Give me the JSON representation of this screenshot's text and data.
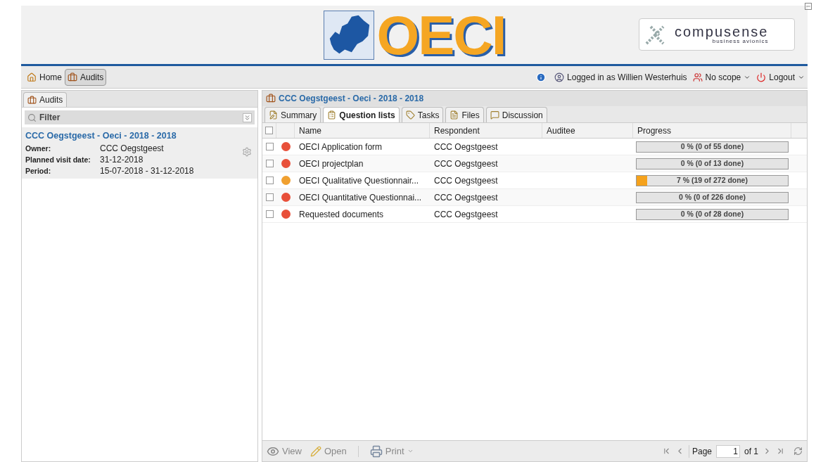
{
  "header": {
    "logo_text": "OECI",
    "partner_logo": {
      "name": "compusense",
      "tagline": "business avionics"
    }
  },
  "nav": {
    "items": [
      {
        "label": "Home",
        "selected": false
      },
      {
        "label": "Audits",
        "selected": true
      }
    ],
    "user": "Logged in as Willien Westerhuis",
    "scope": "No scope",
    "logout": "Logout"
  },
  "sidebar": {
    "tab": "Audits",
    "filter": "Filter",
    "audit": {
      "title": "CCC Oegstgeest - Oeci - 2018 - 2018",
      "fields": [
        {
          "label": "Owner:",
          "value": "CCC Oegstgeest"
        },
        {
          "label": "Planned visit date:",
          "value": "31-12-2018"
        },
        {
          "label": "Period:",
          "value": "15-07-2018 - 31-12-2018"
        }
      ]
    }
  },
  "detail": {
    "title": "CCC Oegstgeest - Oeci - 2018 - 2018",
    "tabs": [
      {
        "label": "Summary",
        "selected": false
      },
      {
        "label": "Question lists",
        "selected": true
      },
      {
        "label": "Tasks",
        "selected": false
      },
      {
        "label": "Files",
        "selected": false
      },
      {
        "label": "Discussion",
        "selected": false
      }
    ],
    "table": {
      "all_checked": false,
      "columns": [
        "Name",
        "Respondent",
        "Auditee",
        "Progress"
      ],
      "rows": [
        {
          "checked": false,
          "color": "#e8503a",
          "name": "OECI Application form",
          "respondent": "CCC Oegstgeest",
          "level": 0,
          "progress": "0 % (0 of 55 done)"
        },
        {
          "checked": false,
          "color": "#e8503a",
          "name": "OECI projectplan",
          "respondent": "CCC Oegstgeest",
          "level": 0,
          "progress": "0 % (0 of 13 done)"
        },
        {
          "checked": false,
          "color": "#f0a030",
          "name": "OECI Qualitative Questionnair...",
          "respondent": "CCC Oegstgeest",
          "level": 0.07,
          "progress": "7 % (19 of 272 done)"
        },
        {
          "checked": false,
          "color": "#e8503a",
          "name": "OECI Quantitative Questionnai...",
          "respondent": "CCC Oegstgeest",
          "level": 0,
          "progress": "0 % (0 of 226 done)"
        },
        {
          "checked": false,
          "color": "#e8503a",
          "name": "Requested documents",
          "respondent": "CCC Oegstgeest",
          "level": 0,
          "progress": "0 % (0 of 28 done)"
        }
      ]
    },
    "toolbar": {
      "view": "View",
      "open": "Open",
      "print": "Print",
      "page_label": "Page",
      "page": "1",
      "of": "of 1"
    }
  }
}
